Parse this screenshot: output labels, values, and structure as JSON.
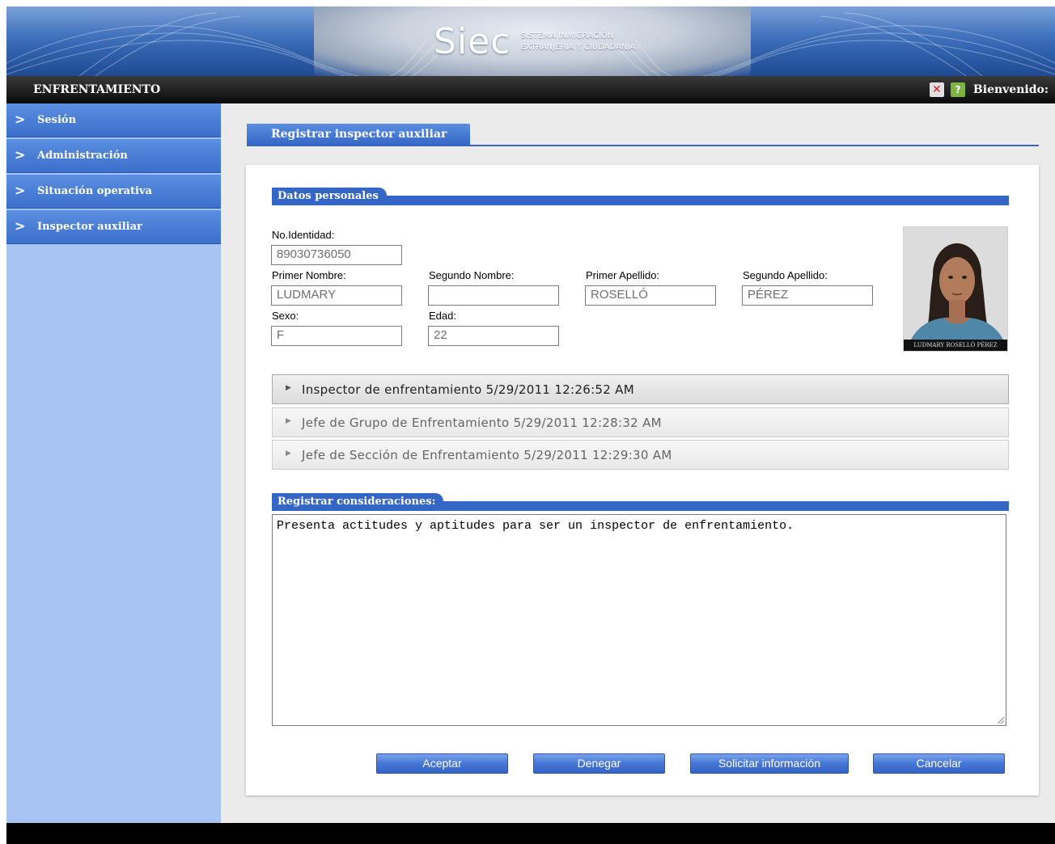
{
  "banner": {
    "logo_word": "Siec",
    "logo_line1": "SISTEMA INMIGRACIÓN",
    "logo_line2": "EXTRANJERIA Y CIUDADANIA"
  },
  "topbar": {
    "title": "ENFRENTAMIENTO",
    "close_icon": "close-icon",
    "help_icon": "help-icon",
    "help_glyph": "?",
    "close_glyph": "✕",
    "welcome": "Bienvenido:"
  },
  "sidebar": {
    "items": [
      {
        "label": "Sesión"
      },
      {
        "label": "Administración"
      },
      {
        "label": "Situación operativa"
      },
      {
        "label": "Inspector auxiliar"
      }
    ]
  },
  "page": {
    "tab_title": "Registrar inspector auxiliar"
  },
  "personal": {
    "section_title": "Datos personales",
    "id_label": "No.Identidad:",
    "id_value": "89030736050",
    "first_name_label": "Primer Nombre:",
    "first_name_value": "LUDMARY",
    "second_name_label": "Segundo Nombre:",
    "second_name_value": "",
    "first_surname_label": "Primer Apellido:",
    "first_surname_value": "ROSELLÓ",
    "second_surname_label": "Segundo Apellido:",
    "second_surname_value": "PÉREZ",
    "sex_label": "Sexo:",
    "sex_value": "F",
    "age_label": "Edad:",
    "age_value": "22",
    "photo_caption": "LUDMARY ROSELLÓ PÉREZ"
  },
  "history": [
    {
      "text": "Inspector de enfrentamiento 5/29/2011 12:26:52 AM"
    },
    {
      "text": "Jefe de Grupo de Enfrentamiento 5/29/2011 12:28:32 AM"
    },
    {
      "text": "Jefe de Sección de Enfrentamiento 5/29/2011 12:29:30 AM"
    }
  ],
  "considerations": {
    "section_title": "Registrar consideraciones:",
    "text": "Presenta actitudes y aptitudes para ser un inspector de enfrentamiento."
  },
  "actions": {
    "accept": "Aceptar",
    "deny": "Denegar",
    "request_info": "Solicitar información",
    "cancel": "Cancelar"
  },
  "colors": {
    "accent": "#3466c6",
    "sidebar_bg": "#a8c4f2",
    "topbar_bg": "#0a0a0a"
  }
}
